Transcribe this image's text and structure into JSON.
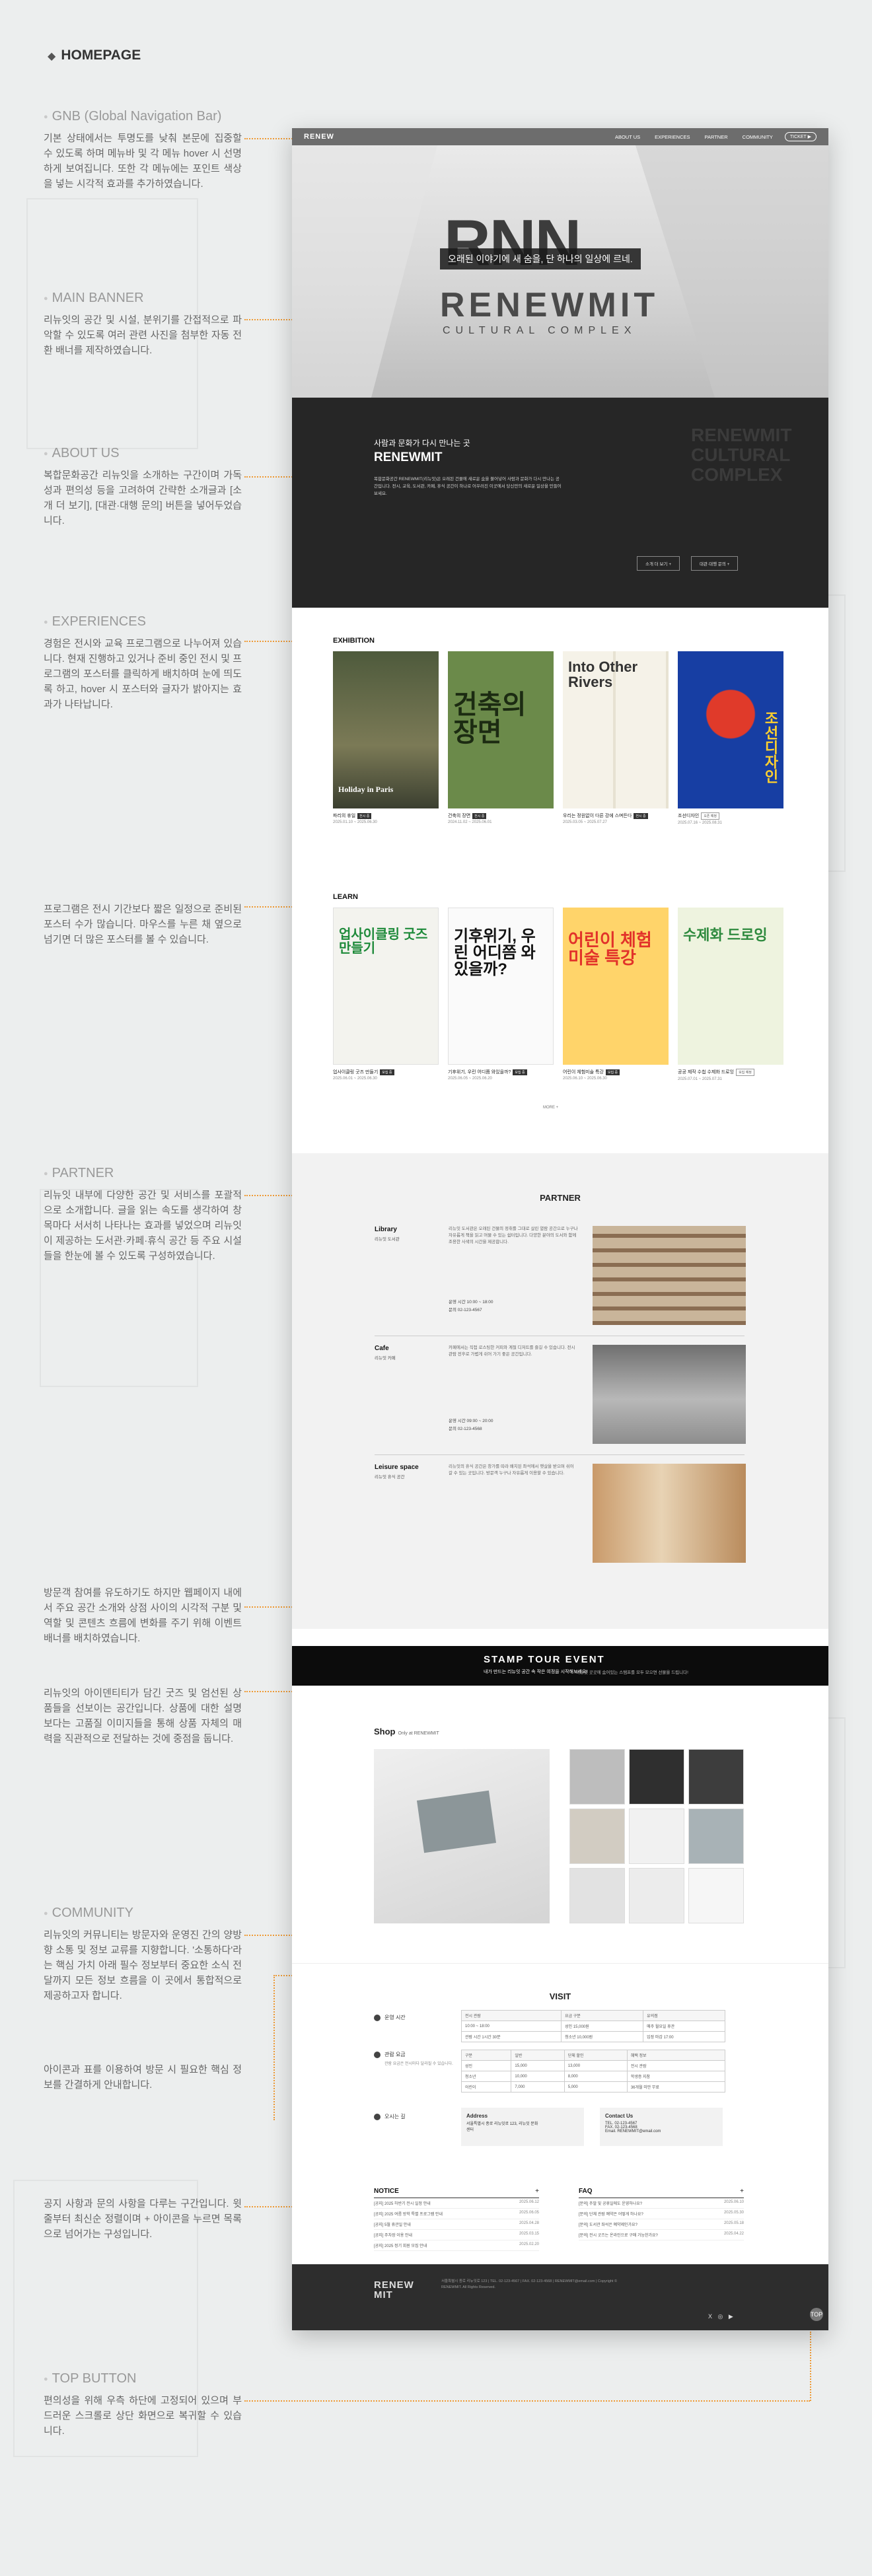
{
  "page": {
    "header": "HOMEPAGE"
  },
  "annotations": [
    {
      "title": "GNB (Global Navigation Bar)",
      "text": "기본 상태에서는 투명도를 낮춰 본문에 집중할 수 있도록 하며 메뉴바 및 각 메뉴 hover 시 선명하게 보여집니다. 또한 각 메뉴에는 포인트 색상을 넣는 시각적 효과를 추가하였습니다."
    },
    {
      "title": "MAIN BANNER",
      "text": "리뉴잇의 공간 및 시설, 분위기를 간접적으로 파악할 수 있도록 여러 관련 사진을 첨부한 자동 전환 배너를 제작하였습니다."
    },
    {
      "title": "ABOUT US",
      "text": "복합문화공간 리뉴잇을 소개하는 구간이며 가독성과 편의성 등을 고려하여 간략한 소개글과 [소개 더 보기], [대관·대행 문의] 버튼을 넣어두었습니다."
    },
    {
      "title": "EXPERIENCES",
      "text": "경험은 전시와 교육 프로그램으로 나누어져 있습니다. 현재 진행하고 있거나 준비 중인 전시 및 프로그램의 포스터를 클릭하게 배치하며 눈에 띄도록 하고, hover 시 포스터와 글자가 밝아지는 효과가 나타납니다."
    },
    {
      "title": "",
      "text": "프로그램은 전시 기간보다 짧은 일정으로 준비된 포스터 수가 많습니다. 마우스를 누른 채 옆으로 넘기면 더 많은 포스터를 볼 수 있습니다."
    },
    {
      "title": "PARTNER",
      "text": "리뉴잇 내부에 다양한 공간 및 서비스를 포괄적으로 소개합니다. 글을 읽는 속도를 생각하여 창목마다 서서히 나타나는 효과를 넣었으며 리뉴잇이 제공하는 도서관·카페·휴식 공간 등 주요 시설들을 한눈에 볼 수 있도록 구성하였습니다."
    },
    {
      "title": "",
      "text": "방문객 참여를 유도하기도 하지만 웹페이지 내에서 주요 공간 소개와 상점 사이의 시각적 구분 및 역할 및 콘텐츠 흐름에 변화를 주기 위해 이벤트 배너를 배치하였습니다."
    },
    {
      "title": "",
      "text": "리뉴잇의 아이덴티티가 담긴 굿즈 및 엄선된 상품들을 선보이는 공간입니다. 상품에 대한 설명보다는 고품질 이미지들을 통해 상품 자체의 매력을 직관적으로 전달하는 것에 중점을 둡니다."
    },
    {
      "title": "COMMUNITY",
      "text": "리뉴잇의 커뮤니티는 방문자와 운영진 간의 양방향 소통 및 정보 교류를 지향합니다. '소통하다'라는 핵심 가치 아래 필수 정보부터 중요한 소식 전달까지 모든 정보 흐름을 이 곳에서 통합적으로 제공하고자 합니다."
    },
    {
      "title": "",
      "text": "아이콘과 표를 이용하여 방문 시 필요한 핵심 정보를 간결하게 안내합니다."
    },
    {
      "title": "",
      "text": "공지 사항과 문의 사항을 다루는 구간입니다. 윗줄부터 최신순 정렬이며 + 아이콘을 누르면 목록으로 넘어가는 구성입니다."
    },
    {
      "title": "TOP BUTTON",
      "text": "편의성을 위해 우측 하단에 고정되어 있으며 부드러운 스크롤로 상단 화면으로 복귀할 수 있습니다."
    }
  ],
  "gnb": {
    "logo": "RENEW",
    "menu": [
      "ABOUT US",
      "EXPERIENCES",
      "PARTNER",
      "COMMUNITY"
    ],
    "ticket": "TICKET ▶"
  },
  "banner": {
    "watermark": "RNN",
    "slogan": "오래된 이야기에 새 숨을, 단 하나의 일상에 르네.",
    "name": "RENEWMIT",
    "sub": "CULTURAL COMPLEX"
  },
  "about": {
    "pre": "사람과 문화가 다시 만나는 곳",
    "title": "RENEWMIT",
    "desc": "복합문화공간 RENEWMIT(리뉴잇)은 오래된 건물에 새로운 숨을 불어넣어 사람과 문화가 다시 만나는 공간입니다. 전시, 교육, 도서관, 카페, 휴식 공간이 하나로 어우러진 이곳에서 당신만의 새로운 일상을 만들어 보세요.",
    "btn1": "소개 더 보기 +",
    "btn2": "대관·대행 문의 +",
    "bigname": "RENEWMIT CULTURAL COMPLEX"
  },
  "exhibition": {
    "title": "EXHIBITION",
    "items": [
      {
        "ptitle": "Holiday in Paris",
        "name": "파리의 휴일",
        "tag": "전시 중",
        "date": "2025.01.10 ~ 2025.06.30"
      },
      {
        "ptitle": "건축의 장면",
        "name": "건축의 장면",
        "tag": "전시 중",
        "date": "2024.11.02 ~ 2025.06.01"
      },
      {
        "ptitle": "Into Other Rivers",
        "name": "우리는 정원없이 다른 강에 스며든다",
        "tag": "전시 중",
        "date": "2025.03.05 ~ 2025.07.27"
      },
      {
        "ptitle": "조선디자인",
        "name": "조선디자인",
        "tag": "오픈 예정",
        "date": "2025.07.16 ~ 2025.08.31"
      }
    ]
  },
  "learn": {
    "title": "LEARN",
    "more": "MORE +",
    "items": [
      {
        "ptitle": "업사이클링 굿즈 만들기",
        "name": "업사이클링 굿즈 만들기",
        "tag": "모집 중",
        "date": "2025.06.01 ~ 2025.06.30"
      },
      {
        "ptitle": "기후위기, 우린 어디쯤 와있을까?",
        "name": "기후위기, 우린 어디쯤 와있을까?",
        "tag": "모집 중",
        "date": "2025.06.05 ~ 2025.06.20"
      },
      {
        "ptitle": "어린이 체험미술 특강",
        "name": "어린이 체험미술 특강",
        "tag": "모집 중",
        "date": "2025.06.10 ~ 2025.06.30"
      },
      {
        "ptitle": "수제화 드로잉",
        "name": "공공 제작 수첩 수제화 드로잉",
        "tag": "모집 예정",
        "date": "2025.07.01 ~ 2025.07.31"
      }
    ]
  },
  "partner": {
    "title": "PARTNER",
    "items": [
      {
        "name": "Library",
        "en": "리뉴잇 도서관",
        "desc": "리뉴잇 도서관은 오래된 건물의 정취를 그대로 살린 열람 공간으로 누구나 자유롭게 책을 읽고 머물 수 있는 쉼터입니다. 다양한 분야의 도서와 함께 조용한 사색의 시간을 제공합니다.",
        "hours": "운영 시간  10:00 ~ 18:00",
        "tel": "문의  02-123-4567"
      },
      {
        "name": "Cafe",
        "en": "리뉴잇 카페",
        "desc": "카페에서는 직접 로스팅한 커피와 계절 디저트를 즐길 수 있습니다. 전시 관람 전후로 가볍게 쉬어 가기 좋은 공간입니다.",
        "hours": "운영 시간  09:00 ~ 20:00",
        "tel": "문의  02-123-4568"
      },
      {
        "name": "Leisure space",
        "en": "리뉴잇 휴식 공간",
        "desc": "리뉴잇의 휴식 공간은 창가를 따라 배치된 좌석에서 햇살을 받으며 쉬어 갈 수 있는 곳입니다. 방문객 누구나 자유롭게 이용할 수 있습니다.",
        "hours": "",
        "tel": ""
      }
    ]
  },
  "event": {
    "title": "STAMP TOUR EVENT",
    "sub": "내가 만드는 리뉴잇 공간 속 작은 여정을 시작해보세요!",
    "line": "리뉴잇 곳곳에 숨어있는 스탬프를 모두 모으면 선물을 드립니다!"
  },
  "shop": {
    "title": "Shop",
    "sub": "Only at RENEWMIT"
  },
  "visit": {
    "title": "VISIT",
    "labels": [
      "운영 시간",
      "관람 요금",
      "오시는 길"
    ],
    "hours_head": [
      "전시 관람",
      "요금 구분",
      "유의점"
    ],
    "hours_rows": [
      [
        "10:00 ~ 18:00",
        "성인 15,000원",
        "매주 월요일 휴관"
      ],
      [
        "관람 시간 1시간 30분",
        "청소년 10,000원",
        "입장 마감 17:00"
      ]
    ],
    "fee_head": [
      "구분",
      "일반",
      "단체 할인",
      "혜택 정보"
    ],
    "fee_rows": [
      [
        "성인",
        "15,000",
        "13,000",
        "전시 관람"
      ],
      [
        "청소년",
        "10,000",
        "8,000",
        "학생증 지참"
      ],
      [
        "어린이",
        "7,000",
        "5,000",
        "36개월 미만 무료"
      ]
    ],
    "fee_note": "관람 요금은 전시마다 달라질 수 있습니다.",
    "address_title": "Address",
    "address": "서울특별시 종로 리뉴잇로 123, 리뉴잇 문화센터",
    "contact_title": "Contact Us",
    "tel": "TEL. 02-123-4567",
    "fax": "FAX. 02-123-4568",
    "email": "Email. RENEWMIT@email.com"
  },
  "notice": {
    "title": "NOTICE",
    "plus": "+",
    "items": [
      [
        "[공지]",
        "2025 하반기 전시 일정 안내",
        "2025.06.12"
      ],
      [
        "[공지]",
        "2025 여름 방학 특별 프로그램 안내",
        "2025.06.05"
      ],
      [
        "[공지]",
        "5월 휴관일 안내",
        "2025.04.28"
      ],
      [
        "[공지]",
        "주차장 이용 안내",
        "2025.03.15"
      ],
      [
        "[공지]",
        "2025 정기 회원 모집 안내",
        "2025.02.20"
      ]
    ]
  },
  "faq": {
    "title": "FAQ",
    "plus": "+",
    "items": [
      [
        "[문의]",
        "주말 및 공휴일에도 운영하나요?",
        "2025.06.10"
      ],
      [
        "[문의]",
        "단체 관람 예약은 어떻게 하나요?",
        "2025.05.30"
      ],
      [
        "[문의]",
        "도서관 좌석은 예약제인가요?",
        "2025.05.18"
      ],
      [
        "[문의]",
        "전시 굿즈는 온라인으로 구매 가능한가요?",
        "2025.04.22"
      ]
    ]
  },
  "footer": {
    "logo": "RENEW MIT",
    "info": "서울특별시 종로 리뉴잇로 123 | TEL. 02-123-4567 | FAX. 02-123-4568 | RENEWMIT@email.com | Copyright © RENEWMIT. All Rights Reserved.",
    "sns": "X ◎ ▶"
  },
  "topbtn": "TOP",
  "colors": {
    "accent": "#ef8a1f",
    "dark": "#262626"
  }
}
